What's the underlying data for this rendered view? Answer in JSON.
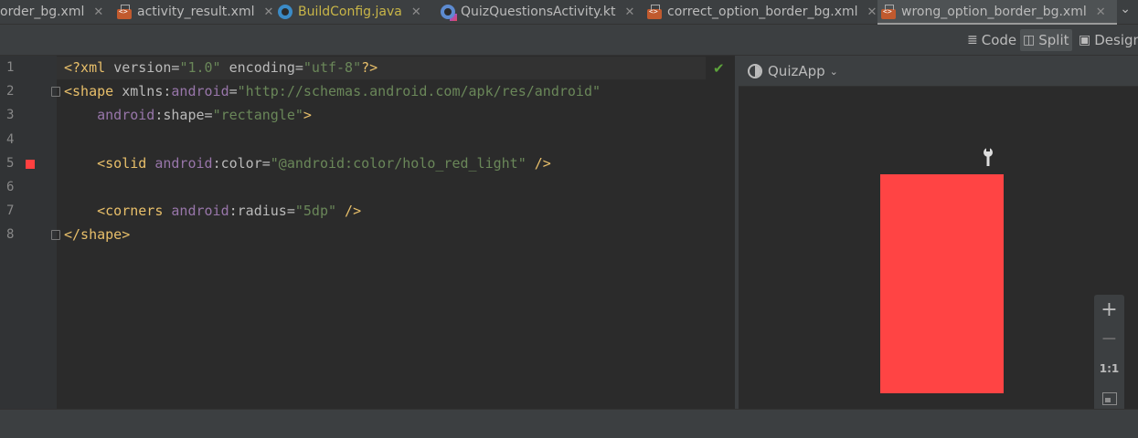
{
  "tabs": [
    {
      "label": "order_bg.xml",
      "icon": "xml-file-icon",
      "active": false
    },
    {
      "label": "activity_result.xml",
      "icon": "xml-file-icon",
      "active": false
    },
    {
      "label": "BuildConfig.java",
      "icon": "java-class-icon",
      "active": false
    },
    {
      "label": "QuizQuestionsActivity.kt",
      "icon": "kotlin-class-icon",
      "active": false
    },
    {
      "label": "correct_option_border_bg.xml",
      "icon": "xml-file-icon",
      "active": false
    },
    {
      "label": "wrong_option_border_bg.xml",
      "icon": "xml-file-icon",
      "active": true
    }
  ],
  "close_glyph": "✕",
  "tab_menu": "⌄",
  "modes": {
    "code": "Code",
    "split": "Split",
    "design": "Design",
    "active": "split"
  },
  "editor": {
    "line_numbers": [
      "1",
      "2",
      "3",
      "4",
      "5",
      "6",
      "7",
      "8"
    ],
    "lines": [
      [
        {
          "t": "<?xml ",
          "c": "tag"
        },
        {
          "t": "version",
          "c": "attr"
        },
        {
          "t": "=",
          "c": "pun"
        },
        {
          "t": "\"1.0\"",
          "c": "val"
        },
        {
          "t": " encoding",
          "c": "attr"
        },
        {
          "t": "=",
          "c": "pun"
        },
        {
          "t": "\"utf-8\"",
          "c": "val"
        },
        {
          "t": "?>",
          "c": "tag"
        }
      ],
      [
        {
          "t": "<shape ",
          "c": "tag"
        },
        {
          "t": "xmlns:",
          "c": "attr"
        },
        {
          "t": "android",
          "c": "ns"
        },
        {
          "t": "=",
          "c": "pun"
        },
        {
          "t": "\"http://schemas.android.com/apk/res/android\"",
          "c": "val"
        }
      ],
      [
        {
          "t": "    android",
          "c": "ns"
        },
        {
          "t": ":shape",
          "c": "attr"
        },
        {
          "t": "=",
          "c": "pun"
        },
        {
          "t": "\"rectangle\"",
          "c": "val"
        },
        {
          "t": ">",
          "c": "tag"
        }
      ],
      [],
      [
        {
          "t": "    <solid ",
          "c": "tag"
        },
        {
          "t": "android",
          "c": "ns"
        },
        {
          "t": ":color",
          "c": "attr"
        },
        {
          "t": "=",
          "c": "pun"
        },
        {
          "t": "\"@android:color/holo_red_light\"",
          "c": "val"
        },
        {
          "t": " />",
          "c": "tag"
        }
      ],
      [],
      [
        {
          "t": "    <corners ",
          "c": "tag"
        },
        {
          "t": "android",
          "c": "ns"
        },
        {
          "t": ":radius",
          "c": "attr"
        },
        {
          "t": "=",
          "c": "pun"
        },
        {
          "t": "\"5dp\"",
          "c": "val"
        },
        {
          "t": " />",
          "c": "tag"
        }
      ],
      [
        {
          "t": "</shape>",
          "c": "tag"
        }
      ]
    ],
    "inspection_status": "ok"
  },
  "preview": {
    "theme_label": "QuizApp",
    "shape_color": "#ff4444",
    "zoom_controls": {
      "zoom_in": "+",
      "zoom_out": "−",
      "actual_size": "1:1"
    }
  }
}
